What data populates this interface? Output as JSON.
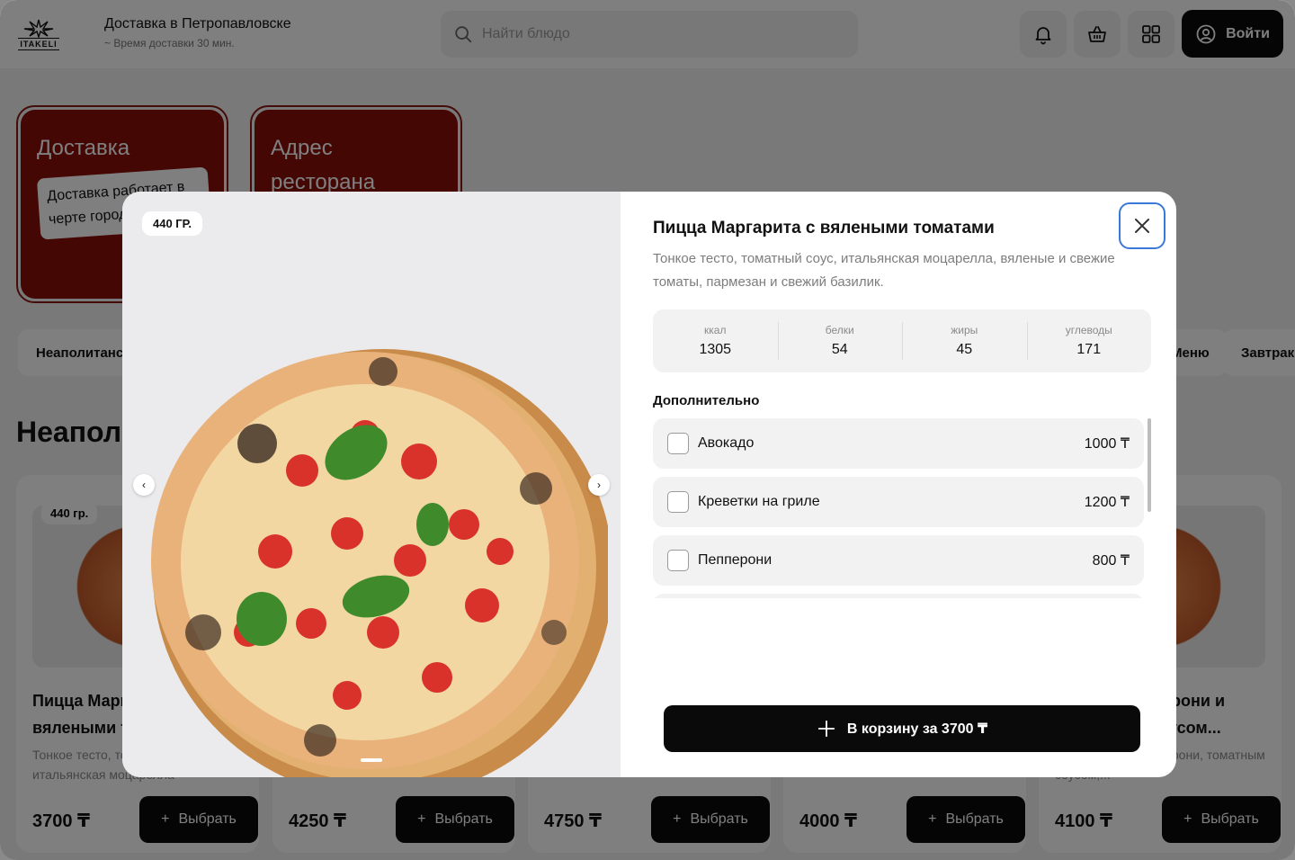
{
  "header": {
    "logo_text": "ITAKELI",
    "delivery_title": "Доставка в Петропавловске",
    "delivery_subtitle": "~ Время доставки 30 мин.",
    "search_placeholder": "Найти блюдо",
    "login_label": "Войти"
  },
  "promos": [
    {
      "title": "Доставка",
      "note": "Доставка работает в черте города"
    },
    {
      "title": "Адрес ресторана"
    }
  ],
  "categories": [
    "Неаполитанские",
    "Меню",
    "Завтраки"
  ],
  "section_title": "Неаполитанские",
  "cards": [
    {
      "weight": "440 гр.",
      "name": "Пицца Маргарита с вялеными томатами",
      "desc": "Тонкое тесто, томатный соус, итальянская моцарелла",
      "price": "3700 ₸",
      "button": "Выбрать"
    },
    {
      "price": "4250 ₸",
      "button": "Выбрать"
    },
    {
      "price": "4750 ₸",
      "button": "Выбрать"
    },
    {
      "price": "4000 ₸",
      "button": "Выбрать"
    },
    {
      "name": "Пицца с пепперони и халапеньо, соусом...",
      "desc": "Тонкое тесто, пепперони, томатным соусом,...",
      "price": "4100 ₸",
      "button": "Выбрать"
    }
  ],
  "modal": {
    "weight": "440 ГР.",
    "title": "Пицца Маргарита с вялеными томатами",
    "description": "Тонкое тесто, томатный соус, итальянская моцарелла, вяленые и свежие томаты, пармезан и свежий базилик.",
    "nutrition": [
      {
        "label": "ккал",
        "value": "1305"
      },
      {
        "label": "белки",
        "value": "54"
      },
      {
        "label": "жиры",
        "value": "45"
      },
      {
        "label": "углеводы",
        "value": "171"
      }
    ],
    "extras_title": "Дополнительно",
    "extras": [
      {
        "name": "Авокадо",
        "price": "1000 ₸",
        "checked": false
      },
      {
        "name": "Креветки на гриле",
        "price": "1200 ₸",
        "checked": false
      },
      {
        "name": "Пепперони",
        "price": "800 ₸",
        "checked": false
      }
    ],
    "add_to_cart": "В корзину за 3700 ₸"
  },
  "colors": {
    "accent_dark": "#0a0a0a",
    "promo_red": "#8a0e08",
    "focus_blue": "#3a79d8"
  }
}
